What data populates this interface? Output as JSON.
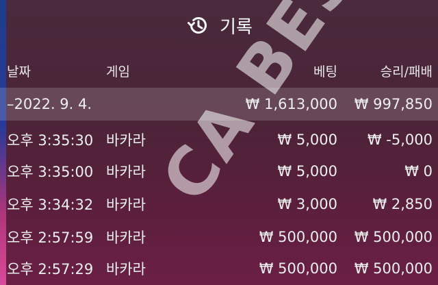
{
  "header": {
    "title": "기록",
    "icon": "history-icon"
  },
  "columns": {
    "date": "날짜",
    "game": "게임",
    "bet": "베팅",
    "winloss": "승리/패배"
  },
  "summary": {
    "date": "–2022. 9. 4.",
    "game": "",
    "bet": "₩ 1,613,000",
    "winloss": "₩ 997,850"
  },
  "rows": [
    {
      "time": "오후 3:35:30",
      "game": "바카라",
      "bet": "₩ 5,000",
      "winloss": "₩ -5,000"
    },
    {
      "time": "오후 3:35:00",
      "game": "바카라",
      "bet": "₩ 5,000",
      "winloss": "₩ 0"
    },
    {
      "time": "오후 3:34:32",
      "game": "바카라",
      "bet": "₩ 3,000",
      "winloss": "₩ 2,850"
    },
    {
      "time": "오후 2:57:59",
      "game": "바카라",
      "bet": "₩ 500,000",
      "winloss": "₩ 500,000"
    },
    {
      "time": "오후 2:57:29",
      "game": "바카라",
      "bet": "₩ 500,000",
      "winloss": "₩ 500,000"
    }
  ],
  "watermark": "CA BEST",
  "colors": {
    "background": "#4b2438",
    "summary_row": "#6a4c5c",
    "text": "#f2f2f2"
  }
}
